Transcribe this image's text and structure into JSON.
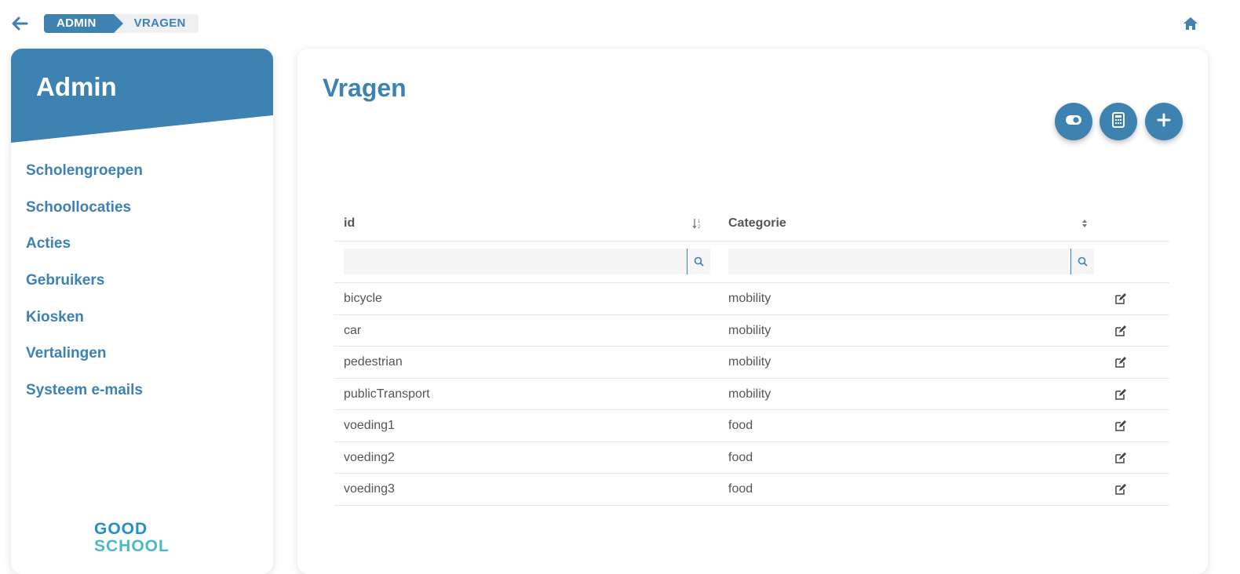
{
  "breadcrumb": {
    "parent": "ADMIN",
    "current": "VRAGEN"
  },
  "sidebar": {
    "title": "Admin",
    "items": [
      {
        "label": "Scholengroepen"
      },
      {
        "label": "Schoollocaties"
      },
      {
        "label": "Acties"
      },
      {
        "label": "Gebruikers"
      },
      {
        "label": "Kiosken"
      },
      {
        "label": "Vertalingen"
      },
      {
        "label": "Systeem e-mails"
      }
    ],
    "logo": {
      "line1": "GOOD",
      "line2": "SCHOOL"
    }
  },
  "main": {
    "title": "Vragen",
    "actions": [
      {
        "icon": "toggle-icon"
      },
      {
        "icon": "calculator-icon"
      },
      {
        "icon": "plus-icon"
      }
    ]
  },
  "table": {
    "columns": [
      {
        "label": "id",
        "sort": "ascending"
      },
      {
        "label": "Categorie",
        "sort": "none"
      }
    ],
    "filters": {
      "id_value": "",
      "categorie_value": ""
    },
    "rows": [
      {
        "id": "bicycle",
        "categorie": "mobility"
      },
      {
        "id": "car",
        "categorie": "mobility"
      },
      {
        "id": "pedestrian",
        "categorie": "mobility"
      },
      {
        "id": "publicTransport",
        "categorie": "mobility"
      },
      {
        "id": "voeding1",
        "categorie": "food"
      },
      {
        "id": "voeding2",
        "categorie": "food"
      },
      {
        "id": "voeding3",
        "categorie": "food"
      }
    ]
  },
  "colors": {
    "accent": "#3d82b1",
    "logo_blue": "#1f8fd0",
    "logo_teal": "#4ab8c8"
  }
}
